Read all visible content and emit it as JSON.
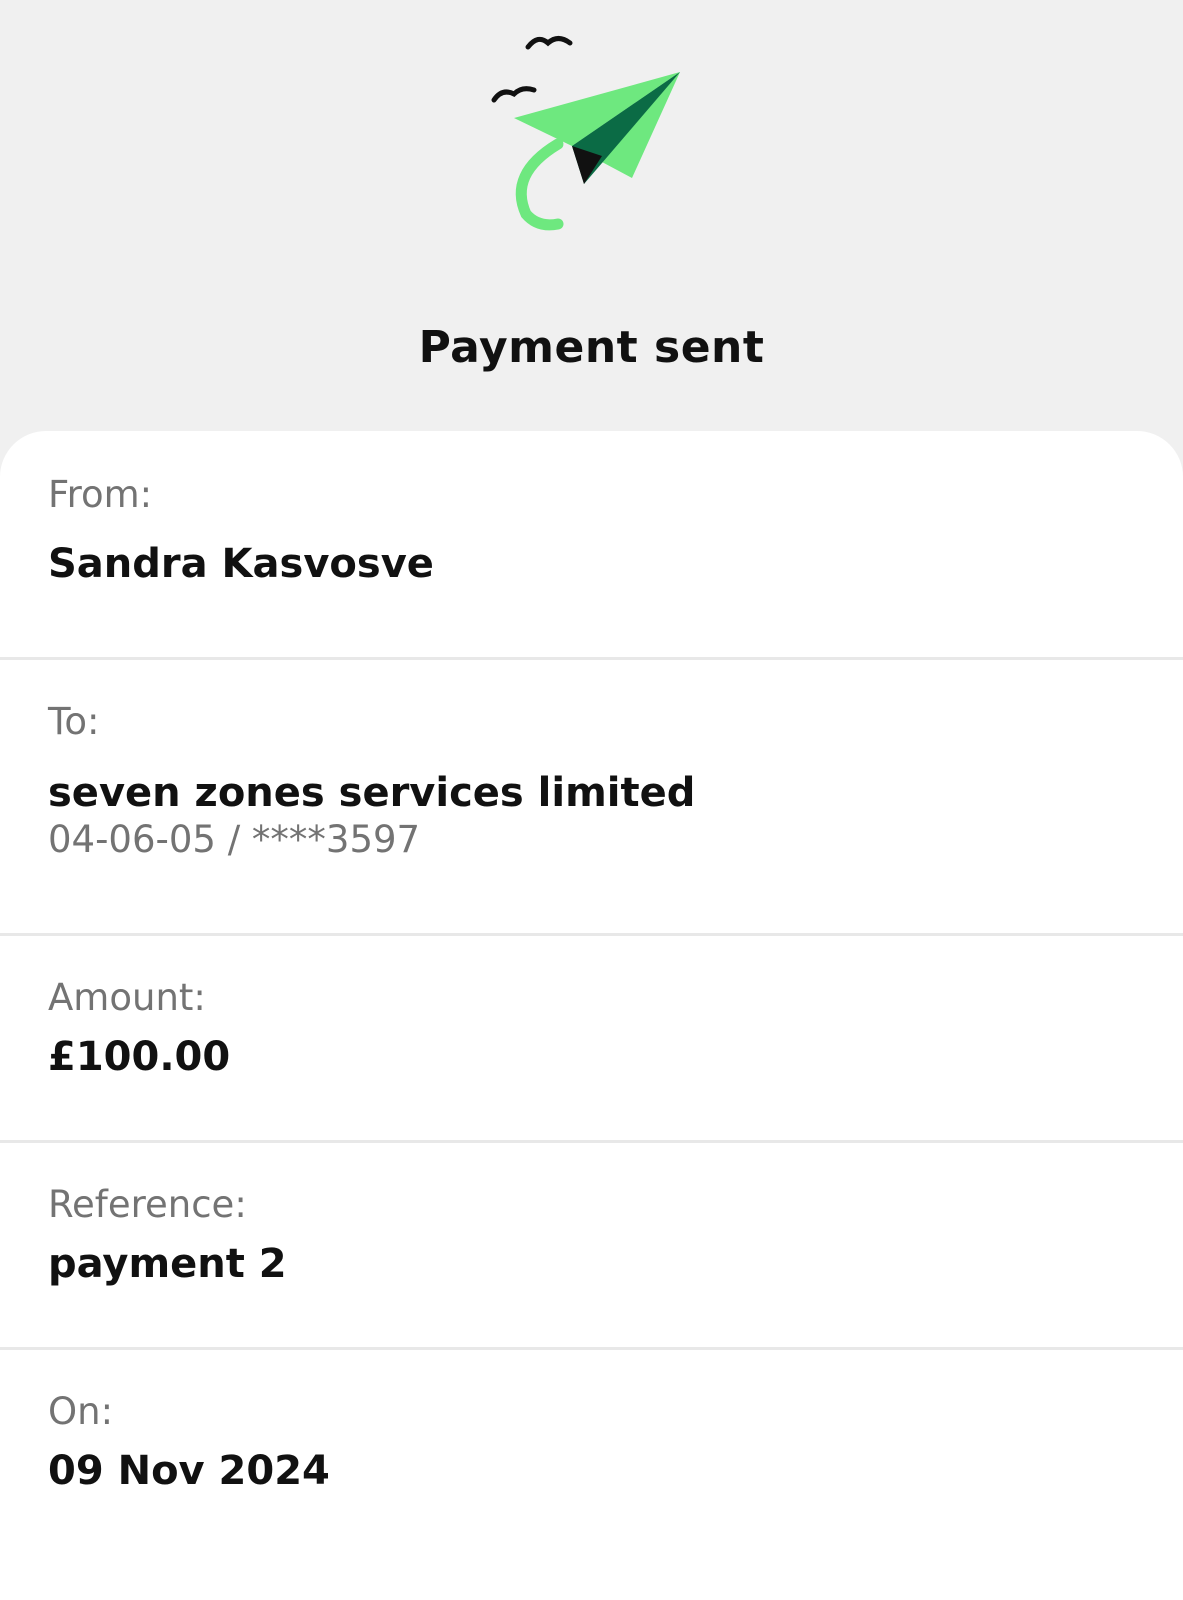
{
  "header": {
    "title": "Payment sent",
    "icon": "paper-plane-icon",
    "accent_color": "#6ee87f",
    "dark_color": "#0b6b45"
  },
  "details": {
    "from": {
      "label": "From:",
      "value": "Sandra Kasvosve"
    },
    "to": {
      "label": "To:",
      "value": "seven zones services limited",
      "account": "04-06-05 / ****3597"
    },
    "amount": {
      "label": "Amount:",
      "value": "£100.00"
    },
    "reference": {
      "label": "Reference:",
      "value": "payment 2"
    },
    "on": {
      "label": "On:",
      "value": "09 Nov 2024"
    }
  }
}
